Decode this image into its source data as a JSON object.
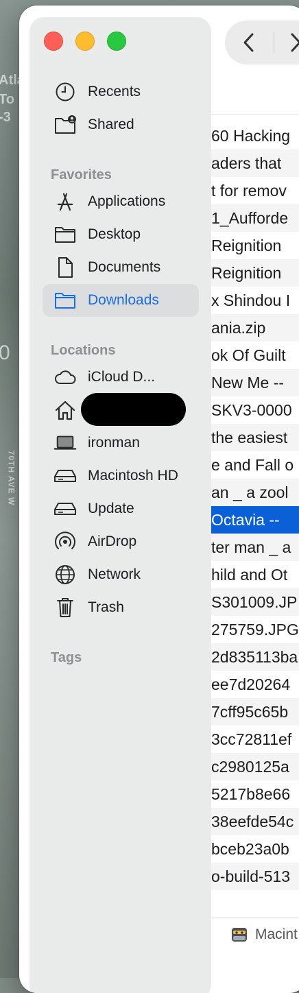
{
  "window": {
    "controls": {
      "close": "close-button",
      "minimize": "minimize-button",
      "maximize": "maximize-button"
    }
  },
  "background": {
    "fragments": [
      "Atla",
      "To",
      "-3",
      "0"
    ],
    "street_label": "70TH AVE W"
  },
  "toolbar": {
    "back_icon": "chevron-left-icon",
    "forward_icon": "chevron-right-icon"
  },
  "sidebar": {
    "top_items": [
      {
        "label": "Recents",
        "icon": "clock-icon"
      },
      {
        "label": "Shared",
        "icon": "shared-folder-icon"
      }
    ],
    "favorites_label": "Favorites",
    "favorites": [
      {
        "label": "Applications",
        "icon": "applications-icon"
      },
      {
        "label": "Desktop",
        "icon": "folder-icon"
      },
      {
        "label": "Documents",
        "icon": "document-icon"
      },
      {
        "label": "Downloads",
        "icon": "downloads-folder-icon",
        "selected": true
      }
    ],
    "locations_label": "Locations",
    "locations": [
      {
        "label": "iCloud D...",
        "icon": "cloud-icon"
      },
      {
        "label": "",
        "icon": "home-icon",
        "redacted": true
      },
      {
        "label": "ironman",
        "icon": "laptop-icon"
      },
      {
        "label": "Macintosh HD",
        "icon": "drive-icon"
      },
      {
        "label": "Update",
        "icon": "drive-icon"
      },
      {
        "label": "AirDrop",
        "icon": "airdrop-icon"
      },
      {
        "label": "Network",
        "icon": "globe-icon"
      },
      {
        "label": "Trash",
        "icon": "trash-icon"
      }
    ],
    "tags_label": "Tags"
  },
  "files": [
    "60 Hacking",
    "aders that",
    "t for remov",
    "1_Aufforde",
    " Reignition",
    " Reignition",
    "x Shindou I",
    "ania.zip",
    "ok Of Guilt",
    "New Me --",
    "SKV3-0000",
    "the easiest",
    "e and Fall o",
    "an _ a zool",
    "Octavia --",
    "ter man _ a",
    "hild and Ot",
    "S301009.JP",
    "275759.JPG",
    "2d835113ba",
    "ee7d20264",
    "7cff95c65b",
    "3cc72811ef",
    "c2980125a",
    "5217b8e66",
    "38eefde54c",
    "bceb23a0b",
    "o-build-513"
  ],
  "selected_file_index": 14,
  "path_bar": {
    "label": "Macint",
    "icon": "macintosh-hd-icon"
  },
  "colors": {
    "accent": "#0a60d6",
    "sidebar_selected_text": "#1a6fe0",
    "close": "#ff5f57",
    "minimize": "#febc2e",
    "maximize": "#28c840"
  }
}
